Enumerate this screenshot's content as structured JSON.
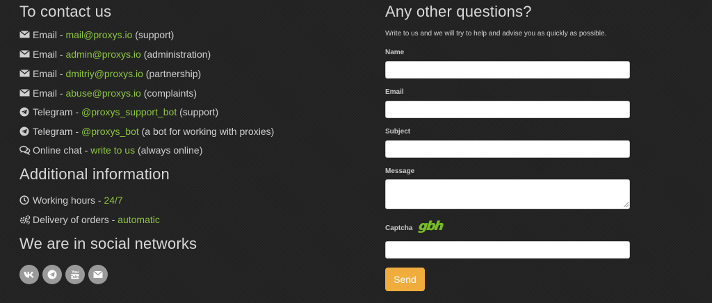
{
  "contacts": {
    "title": "To contact us",
    "items": [
      {
        "icon": "envelope-icon",
        "label": "Email",
        "sep": " - ",
        "link": "mail@proxys.io",
        "note": " (support)"
      },
      {
        "icon": "envelope-icon",
        "label": "Email",
        "sep": " - ",
        "link": "admin@proxys.io",
        "note": " (administration)"
      },
      {
        "icon": "envelope-icon",
        "label": "Email",
        "sep": " - ",
        "link": "dmitriy@proxys.io",
        "note": " (partnership)"
      },
      {
        "icon": "envelope-icon",
        "label": "Email",
        "sep": " - ",
        "link": "abuse@proxys.io",
        "note": " (complaints)"
      },
      {
        "icon": "telegram-icon",
        "label": "Telegram",
        "sep": " - ",
        "link": "@proxys_support_bot",
        "note": " (support)"
      },
      {
        "icon": "telegram-icon",
        "label": "Telegram",
        "sep": " - ",
        "link": "@proxys_bot",
        "note": " (a bot for working with proxies)"
      },
      {
        "icon": "chat-bubbles-icon",
        "label": "Online chat",
        "sep": " - ",
        "link": "write to us",
        "note": " (always online)"
      }
    ]
  },
  "additional": {
    "title": "Additional information",
    "items": [
      {
        "icon": "clock-icon",
        "label": "Working hours",
        "sep": " - ",
        "value": "24/7"
      },
      {
        "icon": "gears-icon",
        "label": "Delivery of orders",
        "sep": " - ",
        "value": "automatic"
      }
    ]
  },
  "social": {
    "title": "We are in social networks",
    "items": [
      "vk-icon",
      "telegram-icon",
      "youtube-icon",
      "envelope-icon"
    ]
  },
  "form": {
    "title": "Any other questions?",
    "description": "Write to us and we will try to help and advise you as quickly as possible.",
    "name_label": "Name",
    "name_value": "",
    "email_label": "Email",
    "email_value": "",
    "subject_label": "Subject",
    "subject_value": "",
    "message_label": "Message",
    "message_value": "",
    "captcha_label": "Captcha",
    "captcha_text": "gbh",
    "captcha_value": "",
    "send_label": "Send"
  },
  "colors": {
    "background": "#232323",
    "link": "#8dc63f",
    "button": "#f0ad3e",
    "social_circle": "#9a9a9a"
  }
}
